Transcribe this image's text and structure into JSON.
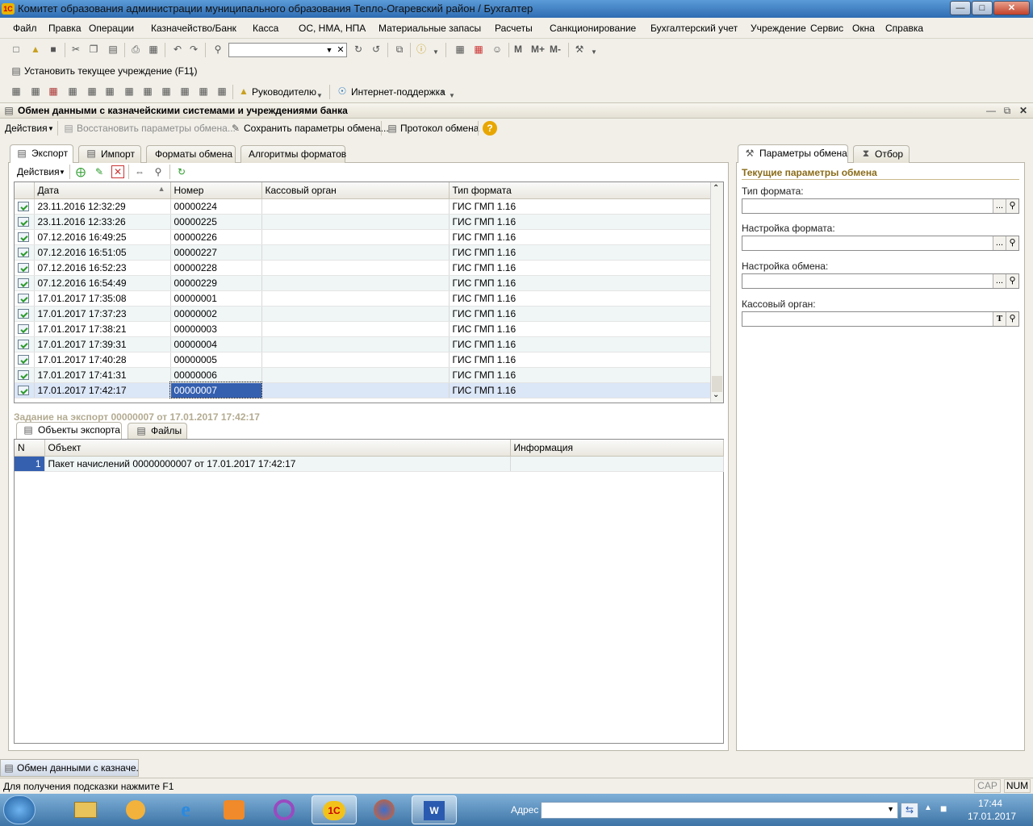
{
  "window": {
    "title": "Комитет образования администрации муниципального образования Тепло-Огаревский район / Бухгалтер",
    "app_icon": "1С"
  },
  "menu": [
    "Файл",
    "Правка",
    "Операции",
    "Казначейство/Банк",
    "Касса",
    "ОС, НМА, НПА",
    "Материальные запасы",
    "Расчеты",
    "Санкционирование",
    "Бухгалтерский учет",
    "Учреждение",
    "Сервис",
    "Окна",
    "Справка"
  ],
  "toolbar": {
    "mem_buttons": [
      "M",
      "M+",
      "M-"
    ]
  },
  "toolbar3": {
    "set_institution": "Установить текущее учреждение (F11)"
  },
  "toolbar4": {
    "manager": "Руководителю",
    "support": "Интернет-поддержка"
  },
  "doc": {
    "title": "Обмен данными с казначейскими системами и учреждениями банка",
    "actions": "Действия",
    "restore": "Восстановить параметры обмена...",
    "save": "Сохранить параметры обмена...",
    "protocol": "Протокол обмена",
    "help": "?"
  },
  "tabs": [
    "Экспорт",
    "Импорт",
    "Форматы обмена",
    "Алгоритмы форматов"
  ],
  "grid": {
    "actions": "Действия",
    "columns": [
      "Дата",
      "Номер",
      "Кассовый орган",
      "Тип формата"
    ],
    "rows": [
      [
        "23.11.2016 12:32:29",
        "00000224",
        "",
        "ГИС ГМП 1.16"
      ],
      [
        "23.11.2016 12:33:26",
        "00000225",
        "",
        "ГИС ГМП 1.16"
      ],
      [
        "07.12.2016 16:49:25",
        "00000226",
        "",
        "ГИС ГМП 1.16"
      ],
      [
        "07.12.2016 16:51:05",
        "00000227",
        "",
        "ГИС ГМП 1.16"
      ],
      [
        "07.12.2016 16:52:23",
        "00000228",
        "",
        "ГИС ГМП 1.16"
      ],
      [
        "07.12.2016 16:54:49",
        "00000229",
        "",
        "ГИС ГМП 1.16"
      ],
      [
        "17.01.2017 17:35:08",
        "00000001",
        "",
        "ГИС ГМП 1.16"
      ],
      [
        "17.01.2017 17:37:23",
        "00000002",
        "",
        "ГИС ГМП 1.16"
      ],
      [
        "17.01.2017 17:38:21",
        "00000003",
        "",
        "ГИС ГМП 1.16"
      ],
      [
        "17.01.2017 17:39:31",
        "00000004",
        "",
        "ГИС ГМП 1.16"
      ],
      [
        "17.01.2017 17:40:28",
        "00000005",
        "",
        "ГИС ГМП 1.16"
      ],
      [
        "17.01.2017 17:41:31",
        "00000006",
        "",
        "ГИС ГМП 1.16"
      ],
      [
        "17.01.2017 17:42:17",
        "00000007",
        "",
        "ГИС ГМП 1.16"
      ]
    ]
  },
  "task": {
    "header": "Задание на экспорт 00000007 от 17.01.2017 17:42:17",
    "tabs": [
      "Объекты экспорта",
      "Файлы"
    ],
    "columns": [
      "N",
      "Объект",
      "Информация"
    ],
    "rows": [
      [
        "1",
        "Пакет начислений 00000000007 от 17.01.2017 17:42:17",
        ""
      ]
    ]
  },
  "right": {
    "tabs": [
      "Параметры обмена",
      "Отбор"
    ],
    "section": "Текущие параметры обмена",
    "fields": [
      {
        "label": "Тип формата:",
        "value": ""
      },
      {
        "label": "Настройка формата:",
        "value": ""
      },
      {
        "label": "Настройка обмена:",
        "value": ""
      },
      {
        "label": "Кассовый орган:",
        "value": ""
      }
    ]
  },
  "taskwindow": "Обмен данными с казначе...",
  "status": {
    "hint": "Для получения подсказки нажмите F1",
    "cap": "CAP",
    "num": "NUM"
  },
  "taskbar": {
    "address_label": "Адрес",
    "time": "17:44",
    "date": "17.01.2017"
  }
}
